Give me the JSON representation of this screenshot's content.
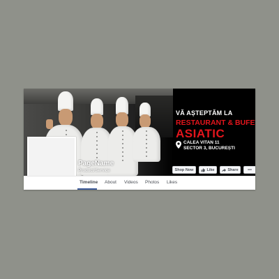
{
  "cover": {
    "slogan_line1": "VĂ AȘTEPTĂM LA",
    "slogan_line2": "RESTAURANT & BUFET",
    "slogan_line3": "ASIATIC",
    "address_line1": "CALEA VITAN 11",
    "address_line2": "SECTOR 3, BUCUREȘTI",
    "icons": [
      "location-pin-icon"
    ]
  },
  "page": {
    "name": "PageName",
    "category": "Product/Service"
  },
  "actions": {
    "shop_now": "Shop Now",
    "like": "Like",
    "share": "Share",
    "more": "•••",
    "icons": [
      "thumbs-up-icon",
      "share-arrow-icon"
    ]
  },
  "tabs": [
    {
      "label": "Timeline"
    },
    {
      "label": "About"
    },
    {
      "label": "Videos"
    },
    {
      "label": "Photos"
    },
    {
      "label": "Likes"
    }
  ],
  "colors": {
    "background": "#8f918a",
    "accent_red": "#e3151c",
    "facebook_blue": "#3b5998"
  }
}
